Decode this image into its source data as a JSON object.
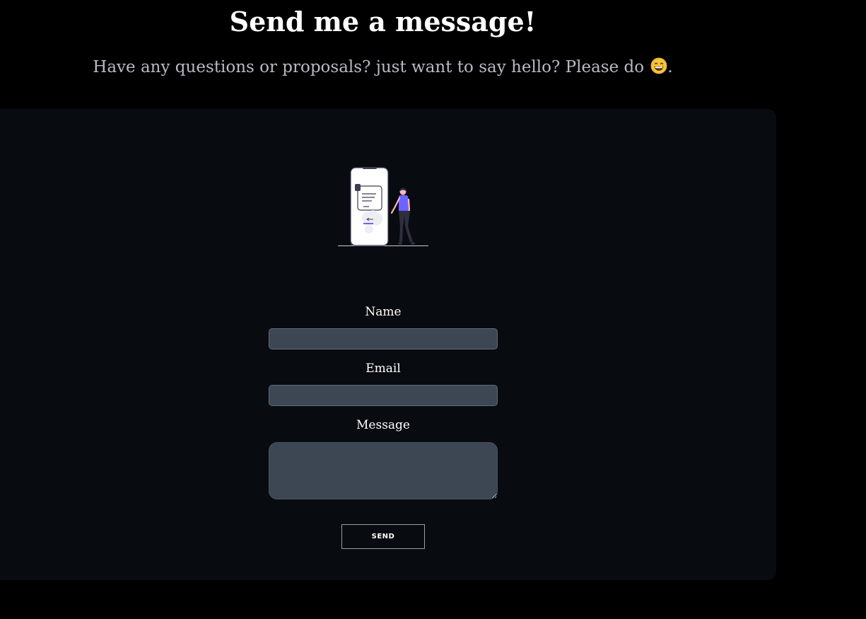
{
  "header": {
    "title": "Send me a message!",
    "subtitle": "Have any questions or proposals? just want to say hello? Please do",
    "subtitle_end": ".",
    "emoji_icon": "grinning-face-emoji"
  },
  "form": {
    "illustration": "person-with-phone-illustration",
    "name_label": "Name",
    "name_value": "",
    "email_label": "Email",
    "email_value": "",
    "message_label": "Message",
    "message_value": "",
    "send_label": "SEND"
  },
  "colors": {
    "page_background": "#000000",
    "card_background": "#080b10",
    "input_background": "#3c4753",
    "subtitle_text": "#b6bcc4",
    "accent_purple": "#6c63ff"
  }
}
